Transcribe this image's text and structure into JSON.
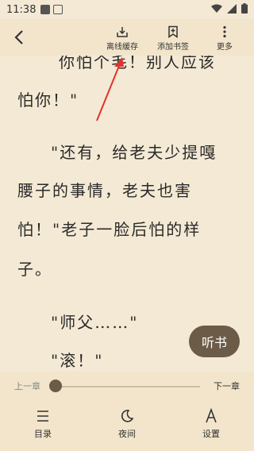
{
  "status": {
    "time": "11:38"
  },
  "toolbar": {
    "offline_cache": "离线缓存",
    "add_bookmark": "添加书签",
    "more": "更多"
  },
  "reading": {
    "lines": [
      "你怕个毛！别人应该",
      "怕你！\"",
      "\"还有，给老夫少提嘎",
      "腰子的事情，老夫也害",
      "怕！\"老子一脸后怕的样",
      "子。",
      "\"师父……\"",
      "\"滚！\""
    ]
  },
  "listen_label": "听书",
  "progress": {
    "prev": "上一章",
    "next": "下一章",
    "value": 0.0
  },
  "bottom_nav": {
    "toc": "目录",
    "night": "夜间",
    "settings": "设置"
  },
  "colors": {
    "background": "#f4e9d4",
    "accent": "#6c5b47",
    "annotation": "#e0322e"
  }
}
